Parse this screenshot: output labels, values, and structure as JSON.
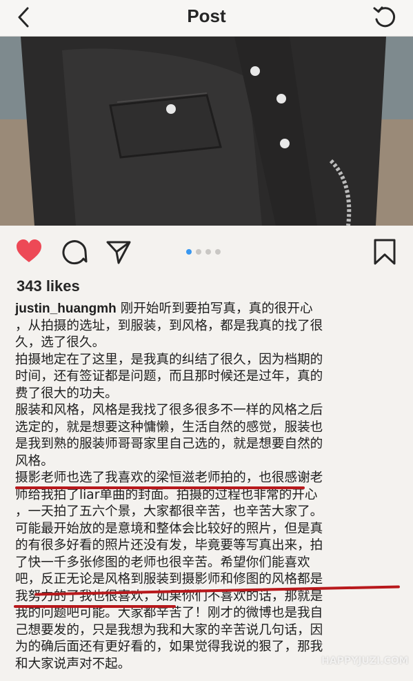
{
  "header": {
    "title": "Post",
    "back_icon": "chevron-left-icon",
    "refresh_icon": "refresh-icon"
  },
  "post": {
    "image_desc_icon": "photo",
    "carousel_active_index": 0,
    "carousel_count": 4,
    "likes": "343 likes",
    "username": "justin_huangmh",
    "caption_lines": [
      "刚开始听到要拍写真，真的很开心",
      "，从拍摄的选址，到服装，到风格，都是我真的找了很",
      "久，选了很久。",
      "拍摄地定在了这里，是我真的纠结了很久，因为档期的",
      "时间，还有签证都是问题，而且那时候还是过年，真的",
      "费了很大的功夫。",
      "服装和风格，风格是我找了很多很多不一样的风格之后",
      "选定的，就是想要这种慵懒，生活自然的感觉，服装也",
      "是我到熟的服装师哥哥家里自己选的，就是想要自然的",
      "风格。",
      "摄影老师也选了我喜欢的梁恒滋老师拍的，也很感谢老",
      "师给我拍了liar单曲的封面。拍摄的过程也非常的开心",
      "，一天拍了五六个景，大家都很辛苦，也辛苦大家了。",
      "可能最开始放的是意境和整体会比较好的照片，但是真",
      "的有很多好看的照片还没有发，毕竟要等写真出来，拍",
      "了快一千多张修图的老师也很辛苦。希望你们能喜欢",
      "吧，反正无论是风格到服装到摄影师和修图的风格都是",
      "我努力的了我也很喜欢，如果你们不喜欢的话，那就是",
      "我的问题吧可能。大家都辛苦了！刚才的微博也是我自",
      "己想要发的，只是我想为我和大家的辛苦说几句话，因",
      "为的确后面还有更好看的，如果觉得我说的狠了，那我",
      "和大家说声对不起。"
    ]
  },
  "colors": {
    "heart": "#ed4956",
    "underline": "#b8191c",
    "active_dot": "#3897f0"
  },
  "watermark": "HAPPYJUZI.COM"
}
